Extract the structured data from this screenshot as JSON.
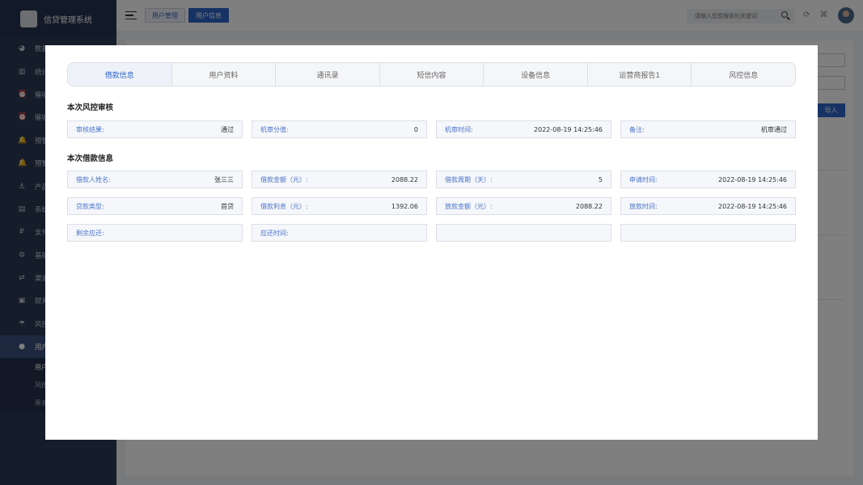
{
  "app": {
    "title": "信贷管理系统"
  },
  "sidebar": {
    "items": [
      {
        "icon": "dashboard-icon",
        "glyph": "◕",
        "label": "数据"
      },
      {
        "icon": "chart-icon",
        "glyph": "▥",
        "label": "统计"
      },
      {
        "icon": "alarm-icon",
        "glyph": "⏰",
        "label": "催收"
      },
      {
        "icon": "alarm-icon",
        "glyph": "⏰",
        "label": "催收"
      },
      {
        "icon": "bell-icon",
        "glyph": "🔔",
        "label": "预警"
      },
      {
        "icon": "bell-icon",
        "glyph": "🔔",
        "label": "预警"
      },
      {
        "icon": "product-icon",
        "glyph": "⚓",
        "label": "产品"
      },
      {
        "icon": "system-icon",
        "glyph": "▤",
        "label": "系统"
      },
      {
        "icon": "payment-icon",
        "glyph": "₽",
        "label": "支付"
      },
      {
        "icon": "settings-icon",
        "glyph": "⚙",
        "label": "基础"
      },
      {
        "icon": "channel-icon",
        "glyph": "⇄",
        "label": "渠道"
      },
      {
        "icon": "finance-icon",
        "glyph": "▣",
        "label": "财务"
      },
      {
        "icon": "risk-icon",
        "glyph": "☂",
        "label": "风控"
      },
      {
        "icon": "user-icon",
        "glyph": "●",
        "label": "用户"
      }
    ],
    "sub_items": [
      {
        "label": "用户"
      },
      {
        "label": "风控"
      },
      {
        "label": "黑名"
      }
    ]
  },
  "header": {
    "breadcrumb": [
      "用户管理",
      "用户信息"
    ],
    "search_placeholder": "请输入您想搜索的关键词"
  },
  "background": {
    "import_label": "导入"
  },
  "modal": {
    "tabs": [
      "借款信息",
      "用户资料",
      "通讯录",
      "短信内容",
      "设备信息",
      "运营商报告1",
      "风控信息"
    ],
    "risk_review": {
      "title": "本次风控审核",
      "fields": [
        {
          "label": "审核结果:",
          "value": "通过"
        },
        {
          "label": "机审分值:",
          "value": "0"
        },
        {
          "label": "机审时间:",
          "value": "2022-08-19 14:25:46"
        },
        {
          "label": "备注:",
          "value": "机审通过"
        }
      ]
    },
    "loan_info": {
      "title": "本次借款信息",
      "rows": [
        [
          {
            "label": "借款人姓名:",
            "value": "张三三"
          },
          {
            "label": "借款金额（元）:",
            "value": "2088.22"
          },
          {
            "label": "借款周期（天）:",
            "value": "5"
          },
          {
            "label": "申请时间:",
            "value": "2022-08-19 14:25:46"
          }
        ],
        [
          {
            "label": "贷款类型:",
            "value": "首贷"
          },
          {
            "label": "借款利息（元）:",
            "value": "1392.06"
          },
          {
            "label": "放款金额（元）:",
            "value": "2088.22"
          },
          {
            "label": "放款时间:",
            "value": "2022-08-19 14:25:46"
          }
        ],
        [
          {
            "label": "剩余应还:",
            "value": ""
          },
          {
            "label": "应还时间:",
            "value": ""
          },
          {
            "label": "",
            "value": ""
          },
          {
            "label": "",
            "value": ""
          }
        ]
      ]
    }
  }
}
